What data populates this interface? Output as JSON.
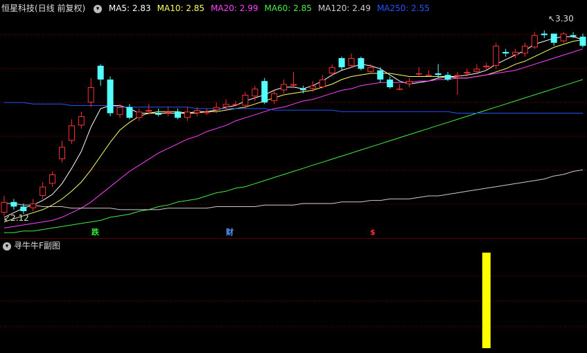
{
  "header": {
    "stock_name": "恒星科技",
    "period": "(日线 前复权)",
    "ma_labels": [
      {
        "text": "MA5: 2.83",
        "color": "#ffffff"
      },
      {
        "text": "MA10: 2.85",
        "color": "#ffff66"
      },
      {
        "text": "MA20: 2.99",
        "color": "#ff44ff"
      },
      {
        "text": "MA60: 2.85",
        "color": "#44ee44"
      },
      {
        "text": "MA120: 2.49",
        "color": "#cccccc"
      },
      {
        "text": "MA250: 2.55",
        "color": "#2255ff"
      }
    ]
  },
  "price_labels": {
    "high": "3.30",
    "low": "2.12"
  },
  "markers": [
    {
      "text": "跌",
      "color": "#33ee33"
    },
    {
      "text": "财",
      "color": "#5599ff"
    },
    {
      "text": "$",
      "color": "#ff3030"
    }
  ],
  "sub_panel": {
    "title": "寻牛牛F副图"
  },
  "colors": {
    "up": "#ff3232",
    "down": "#54ffff",
    "grid": "#5a0000",
    "signal": "#ffff00"
  },
  "chart_data": {
    "type": "candlestick",
    "ylim": [
      2.05,
      3.42
    ],
    "candles": [
      [
        2.13,
        2.2,
        2.24,
        2.11
      ],
      [
        2.2,
        2.17,
        2.22,
        2.15
      ],
      [
        2.17,
        2.14,
        2.19,
        2.12
      ],
      [
        2.16,
        2.19,
        2.22,
        2.14
      ],
      [
        2.24,
        2.3,
        2.33,
        2.22
      ],
      [
        2.32,
        2.38,
        2.4,
        2.3
      ],
      [
        2.48,
        2.56,
        2.6,
        2.46
      ],
      [
        2.6,
        2.7,
        2.74,
        2.58
      ],
      [
        2.7,
        2.76,
        2.79,
        2.68
      ],
      [
        2.85,
        2.95,
        3.01,
        2.82
      ],
      [
        3.09,
        3.0,
        3.1,
        2.96
      ],
      [
        3.0,
        2.78,
        3.02,
        2.76
      ],
      [
        2.77,
        2.82,
        2.84,
        2.75
      ],
      [
        2.82,
        2.75,
        2.84,
        2.74
      ],
      [
        2.75,
        2.79,
        2.81,
        2.73
      ],
      [
        2.79,
        2.8,
        2.84,
        2.77
      ],
      [
        2.78,
        2.77,
        2.81,
        2.76
      ],
      [
        2.78,
        2.79,
        2.82,
        2.76
      ],
      [
        2.79,
        2.75,
        2.81,
        2.74
      ],
      [
        2.75,
        2.79,
        2.82,
        2.73
      ],
      [
        2.78,
        2.8,
        2.82,
        2.76
      ],
      [
        2.78,
        2.79,
        2.81,
        2.77
      ],
      [
        2.8,
        2.82,
        2.85,
        2.78
      ],
      [
        2.82,
        2.84,
        2.87,
        2.8
      ],
      [
        2.84,
        2.84,
        2.86,
        2.83
      ],
      [
        2.83,
        2.9,
        2.92,
        2.81
      ],
      [
        2.89,
        2.94,
        2.96,
        2.86
      ],
      [
        2.99,
        2.85,
        3.01,
        2.84
      ],
      [
        2.86,
        2.91,
        2.93,
        2.84
      ],
      [
        2.93,
        2.97,
        3.0,
        2.91
      ],
      [
        2.96,
        2.97,
        3.05,
        2.95
      ],
      [
        2.94,
        2.93,
        2.96,
        2.91
      ],
      [
        2.94,
        2.96,
        2.99,
        2.92
      ],
      [
        2.95,
        3.0,
        3.03,
        2.94
      ],
      [
        3.04,
        3.08,
        3.1,
        3.02
      ],
      [
        3.14,
        3.08,
        3.15,
        3.06
      ],
      [
        3.09,
        3.14,
        3.17,
        3.08
      ],
      [
        3.14,
        3.07,
        3.15,
        3.06
      ],
      [
        3.05,
        3.08,
        3.1,
        3.04
      ],
      [
        3.06,
        3.0,
        3.08,
        2.98
      ],
      [
        3.0,
        2.95,
        3.02,
        2.94
      ],
      [
        2.94,
        2.94,
        2.97,
        2.93
      ],
      [
        2.97,
        2.99,
        3.01,
        2.95
      ],
      [
        3.04,
        3.04,
        3.08,
        3.02
      ],
      [
        3.03,
        3.03,
        3.06,
        3.02
      ],
      [
        3.04,
        3.03,
        3.1,
        3.01
      ],
      [
        3.03,
        3.0,
        3.05,
        2.99
      ],
      [
        3.02,
        3.03,
        3.05,
        2.9
      ],
      [
        3.04,
        3.05,
        3.07,
        3.02
      ],
      [
        3.05,
        3.07,
        3.1,
        3.04
      ],
      [
        3.08,
        3.09,
        3.11,
        3.06
      ],
      [
        3.09,
        3.22,
        3.24,
        3.07
      ],
      [
        3.18,
        3.17,
        3.2,
        3.15
      ],
      [
        3.16,
        3.18,
        3.2,
        3.14
      ],
      [
        3.17,
        3.22,
        3.24,
        3.15
      ],
      [
        3.21,
        3.29,
        3.31,
        3.2
      ],
      [
        3.3,
        3.29,
        3.32,
        3.27
      ],
      [
        3.3,
        3.24,
        3.3,
        3.22
      ],
      [
        3.25,
        3.3,
        3.31,
        3.24
      ],
      [
        3.29,
        3.28,
        3.31,
        3.27
      ],
      [
        3.28,
        3.22,
        3.3,
        3.21
      ]
    ],
    "ma": [
      {
        "name": "MA5",
        "color": "#ffffff",
        "values": [
          2.1,
          2.13,
          2.16,
          2.18,
          2.21,
          2.25,
          2.32,
          2.42,
          2.53,
          2.69,
          2.81,
          2.83,
          2.83,
          2.81,
          2.78,
          2.78,
          2.78,
          2.78,
          2.78,
          2.78,
          2.79,
          2.79,
          2.8,
          2.82,
          2.83,
          2.86,
          2.88,
          2.9,
          2.93,
          2.95,
          2.95,
          2.94,
          2.96,
          2.99,
          3.03,
          3.06,
          3.08,
          3.1,
          3.09,
          3.07,
          3.03,
          2.99,
          2.97,
          2.98,
          2.99,
          3.01,
          3.02,
          3.02,
          3.03,
          3.04,
          3.06,
          3.1,
          3.13,
          3.16,
          3.19,
          3.23,
          3.25,
          3.27,
          3.28,
          3.28,
          3.26
        ]
      },
      {
        "name": "MA10",
        "color": "#ffff66",
        "values": [
          2.07,
          2.09,
          2.11,
          2.13,
          2.15,
          2.18,
          2.22,
          2.27,
          2.33,
          2.41,
          2.5,
          2.59,
          2.67,
          2.72,
          2.76,
          2.78,
          2.79,
          2.79,
          2.79,
          2.78,
          2.78,
          2.79,
          2.79,
          2.8,
          2.81,
          2.82,
          2.84,
          2.86,
          2.88,
          2.9,
          2.91,
          2.92,
          2.93,
          2.95,
          2.97,
          3.0,
          3.02,
          3.03,
          3.04,
          3.04,
          3.04,
          3.03,
          3.02,
          3.02,
          3.02,
          3.02,
          3.02,
          3.01,
          3.01,
          3.02,
          3.03,
          3.05,
          3.07,
          3.1,
          3.12,
          3.15,
          3.18,
          3.21,
          3.23,
          3.25,
          3.26
        ]
      },
      {
        "name": "MA20",
        "color": "#ff44ff",
        "values": [
          2.03,
          2.04,
          2.05,
          2.06,
          2.07,
          2.08,
          2.1,
          2.13,
          2.16,
          2.2,
          2.25,
          2.3,
          2.35,
          2.4,
          2.44,
          2.48,
          2.52,
          2.55,
          2.58,
          2.61,
          2.63,
          2.66,
          2.68,
          2.7,
          2.73,
          2.75,
          2.77,
          2.79,
          2.81,
          2.82,
          2.84,
          2.86,
          2.87,
          2.89,
          2.91,
          2.93,
          2.94,
          2.96,
          2.97,
          2.98,
          2.98,
          2.98,
          2.98,
          2.99,
          2.99,
          3.0,
          3.0,
          3.01,
          3.01,
          3.02,
          3.03,
          3.04,
          3.05,
          3.06,
          3.08,
          3.1,
          3.12,
          3.14,
          3.16,
          3.18,
          3.2
        ]
      },
      {
        "name": "MA60",
        "color": "#44ee44",
        "values": [
          2.0,
          2.0,
          2.01,
          2.01,
          2.02,
          2.03,
          2.04,
          2.05,
          2.06,
          2.07,
          2.08,
          2.1,
          2.11,
          2.12,
          2.14,
          2.15,
          2.17,
          2.18,
          2.2,
          2.21,
          2.22,
          2.24,
          2.26,
          2.27,
          2.29,
          2.3,
          2.32,
          2.34,
          2.36,
          2.38,
          2.4,
          2.42,
          2.44,
          2.46,
          2.48,
          2.5,
          2.52,
          2.54,
          2.56,
          2.58,
          2.6,
          2.62,
          2.64,
          2.66,
          2.68,
          2.7,
          2.72,
          2.74,
          2.76,
          2.78,
          2.8,
          2.82,
          2.84,
          2.86,
          2.88,
          2.9,
          2.92,
          2.94,
          2.96,
          2.98,
          3.0
        ]
      },
      {
        "name": "MA120",
        "color": "#cccccc",
        "values": [
          2.19,
          2.19,
          2.18,
          2.18,
          2.17,
          2.17,
          2.17,
          2.16,
          2.16,
          2.16,
          2.16,
          2.16,
          2.15,
          2.15,
          2.15,
          2.15,
          2.15,
          2.16,
          2.16,
          2.16,
          2.16,
          2.16,
          2.17,
          2.17,
          2.17,
          2.17,
          2.17,
          2.18,
          2.18,
          2.18,
          2.18,
          2.19,
          2.19,
          2.19,
          2.19,
          2.2,
          2.2,
          2.2,
          2.21,
          2.21,
          2.22,
          2.22,
          2.22,
          2.23,
          2.24,
          2.24,
          2.25,
          2.26,
          2.27,
          2.28,
          2.29,
          2.3,
          2.31,
          2.32,
          2.33,
          2.34,
          2.35,
          2.37,
          2.38,
          2.4,
          2.41
        ]
      },
      {
        "name": "MA250",
        "color": "#2255ff",
        "values": [
          2.85,
          2.85,
          2.85,
          2.84,
          2.84,
          2.84,
          2.84,
          2.83,
          2.83,
          2.83,
          2.83,
          2.83,
          2.82,
          2.82,
          2.82,
          2.82,
          2.82,
          2.82,
          2.82,
          2.82,
          2.81,
          2.81,
          2.81,
          2.81,
          2.81,
          2.81,
          2.81,
          2.81,
          2.8,
          2.8,
          2.8,
          2.8,
          2.8,
          2.8,
          2.8,
          2.79,
          2.79,
          2.79,
          2.79,
          2.79,
          2.79,
          2.79,
          2.79,
          2.79,
          2.79,
          2.79,
          2.79,
          2.78,
          2.78,
          2.78,
          2.78,
          2.78,
          2.78,
          2.78,
          2.78,
          2.78,
          2.78,
          2.78,
          2.78,
          2.78,
          2.78
        ]
      }
    ],
    "signal": {
      "bar_index": 50,
      "value": 1
    }
  }
}
